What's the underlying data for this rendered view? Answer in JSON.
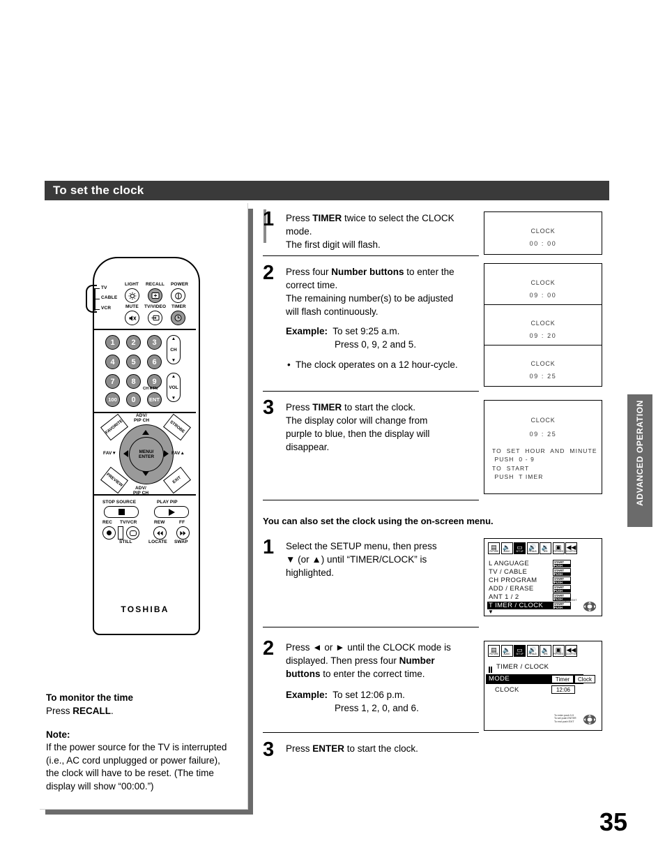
{
  "section": {
    "title": "To set the clock"
  },
  "page": {
    "number": "35",
    "side_tab": "ADVANCED OPERATION"
  },
  "remote": {
    "brand": "TOSHIBA",
    "mode_switch": [
      "TV",
      "CABLE",
      "VCR"
    ],
    "top_labels": [
      "LIGHT",
      "RECALL",
      "POWER",
      "MUTE",
      "TV/VIDEO",
      "TIMER"
    ],
    "numbers": [
      "1",
      "2",
      "3",
      "4",
      "5",
      "6",
      "7",
      "8",
      "9",
      "100",
      "0",
      "ENT"
    ],
    "ent_sub": "CH RTN",
    "rockers": [
      "CH",
      "VOL"
    ],
    "nav": {
      "center": [
        "MENU/",
        "ENTER"
      ],
      "up": [
        "ADV/",
        "PIP CH"
      ],
      "down": [
        "ADV/",
        "PIP CH"
      ],
      "left": "FAV▼",
      "right": "FAV▲",
      "corners": [
        "FAVORITE",
        "STROBE",
        "PREVIEW",
        "EXIT"
      ]
    },
    "transport": {
      "stop_source": "STOP SOURCE",
      "play_pip": "PLAY PIP",
      "rec": "REC",
      "tvvcr": "TV/VCR",
      "rew": "REW",
      "ff": "FF",
      "still": "STILL",
      "locate": "LOCATE",
      "swap": "SWAP"
    }
  },
  "left_notes": {
    "monitor_title": "To monitor the time",
    "monitor_body_pre": "Press ",
    "monitor_body_bold": "RECALL",
    "monitor_body_post": ".",
    "note_title": "Note:",
    "note_body": "If the power source for the TV is interrupted (i.e., AC cord unplugged or power failure), the clock will have to be reset. (The time display will show “00:00.”)"
  },
  "steps": [
    {
      "num": "1",
      "line1_pre": "Press ",
      "line1_bold": "TIMER",
      "line1_post": " twice to select the CLOCK",
      "line2": "mode.",
      "line3": "The first digit will flash."
    },
    {
      "num": "2",
      "line1_pre": "Press four ",
      "line1_bold": "Number buttons",
      "line1_post": " to enter the",
      "line2": "correct time.",
      "line3": "The remaining number(s) to be adjusted",
      "line4": "will flash continuously.",
      "example_label": "Example:",
      "example_line1": "To set 9:25 a.m.",
      "example_line2": "Press 0, 9, 2 and 5.",
      "bullet": "The clock operates on a 12 hour-cycle."
    },
    {
      "num": "3",
      "line1_pre": "Press ",
      "line1_bold": "TIMER",
      "line1_post": " to start the clock.",
      "line2": "The display color will change from",
      "line3": "purple to blue, then the display will",
      "line4": "disappear."
    }
  ],
  "clock_displays": [
    {
      "title": "CLOCK",
      "time": "00 : 00"
    },
    {
      "title": "CLOCK",
      "time": "09 : 00"
    },
    {
      "title": "CLOCK",
      "time": "09 : 20"
    },
    {
      "title": "CLOCK",
      "time": "09 : 25"
    }
  ],
  "clock_display_big": {
    "title": "CLOCK",
    "time": "09 : 25",
    "lines": "TO  SET  HOUR  AND  MINUTE\n PUSH  0 - 9\nTO  START\n PUSH  T IMER"
  },
  "onscreen": {
    "subhead": "You can also set the clock using the on-screen menu.",
    "steps": [
      {
        "num": "1",
        "line1": "Select the SETUP menu, then press",
        "line2": "▼ (or ▲) until “TIMER/CLOCK” is",
        "line3": "highlighted."
      },
      {
        "num": "2",
        "line1_pre": "Press ",
        "line1_arrows": "◄ or ►",
        "line1_post": " until the CLOCK mode is",
        "line2_pre": "displayed. Then press four ",
        "line2_bold": "Number",
        "line3_bold": "buttons",
        "line3_post": " to enter the correct time.",
        "example_label": "Example:",
        "example_line1": "To set 12:06 p.m.",
        "example_line2": "Press 1, 2, 0, and 6."
      },
      {
        "num": "3",
        "line1_pre": "Press ",
        "line1_bold": "ENTER",
        "line1_post": " to start the clock."
      }
    ]
  },
  "setup_menu": {
    "icons": [
      {
        "glyph": "▤",
        "cap": "PICTURE",
        "selected": false
      },
      {
        "glyph": "◂)",
        "cap": "AUDIO",
        "selected": false
      },
      {
        "glyph": "▭",
        "cap": "SET UP",
        "selected": true
      },
      {
        "glyph": "◂))",
        "cap": "PIP/AUD",
        "selected": false
      },
      {
        "glyph": "◂≈",
        "cap": "SRS",
        "selected": false
      },
      {
        "glyph": "▣",
        "cap": "PIP/VIDEO",
        "selected": false
      },
      {
        "glyph": "◄◄",
        "cap": "CC/OPTION",
        "selected": false
      }
    ],
    "rows": [
      {
        "label": "L ANGUAGE",
        "action_top": "START",
        "action_bot": "PUSH",
        "highlighted": false
      },
      {
        "label": "TV / CABLE",
        "action_top": "START",
        "action_bot": "PUSH",
        "highlighted": false
      },
      {
        "label": "CH   PROGRAM",
        "action_top": "START",
        "action_bot": "PUSH",
        "highlighted": false
      },
      {
        "label": "ADD / ERASE",
        "action_top": "START",
        "action_bot": "PUSH",
        "highlighted": false
      },
      {
        "label": "ANT 1 / 2",
        "action_top": "START",
        "action_bot": "PUSH",
        "highlighted": false
      },
      {
        "label": "T IMER / CLOCK",
        "action_top": "START",
        "action_bot": "PUSH",
        "highlighted": true
      }
    ],
    "scroll_caret": "▼",
    "helper": "To end push EXIT"
  },
  "timer_clock_menu": {
    "icons": [
      {
        "glyph": "▤",
        "cap": "PICTURE",
        "selected": false
      },
      {
        "glyph": "◂)",
        "cap": "AUDIO",
        "selected": false
      },
      {
        "glyph": "▭",
        "cap": "SET UP",
        "selected": true
      },
      {
        "glyph": "◂))",
        "cap": "PIP/AUD",
        "selected": false
      },
      {
        "glyph": "◂≈",
        "cap": "SRS",
        "selected": false
      },
      {
        "glyph": "▣",
        "cap": "PIP/VIDEO",
        "selected": false
      },
      {
        "glyph": "◄◄",
        "cap": "CC/OPTION",
        "selected": false
      }
    ],
    "title": "TIMER / CLOCK",
    "mode_label": "MODE",
    "mode_options": [
      "Timer",
      "Clock"
    ],
    "clock_label": "CLOCK",
    "clock_value": "12:06",
    "helper": "To enter push 0-9\nTo set push ENTER\nTo end push EXIT"
  }
}
